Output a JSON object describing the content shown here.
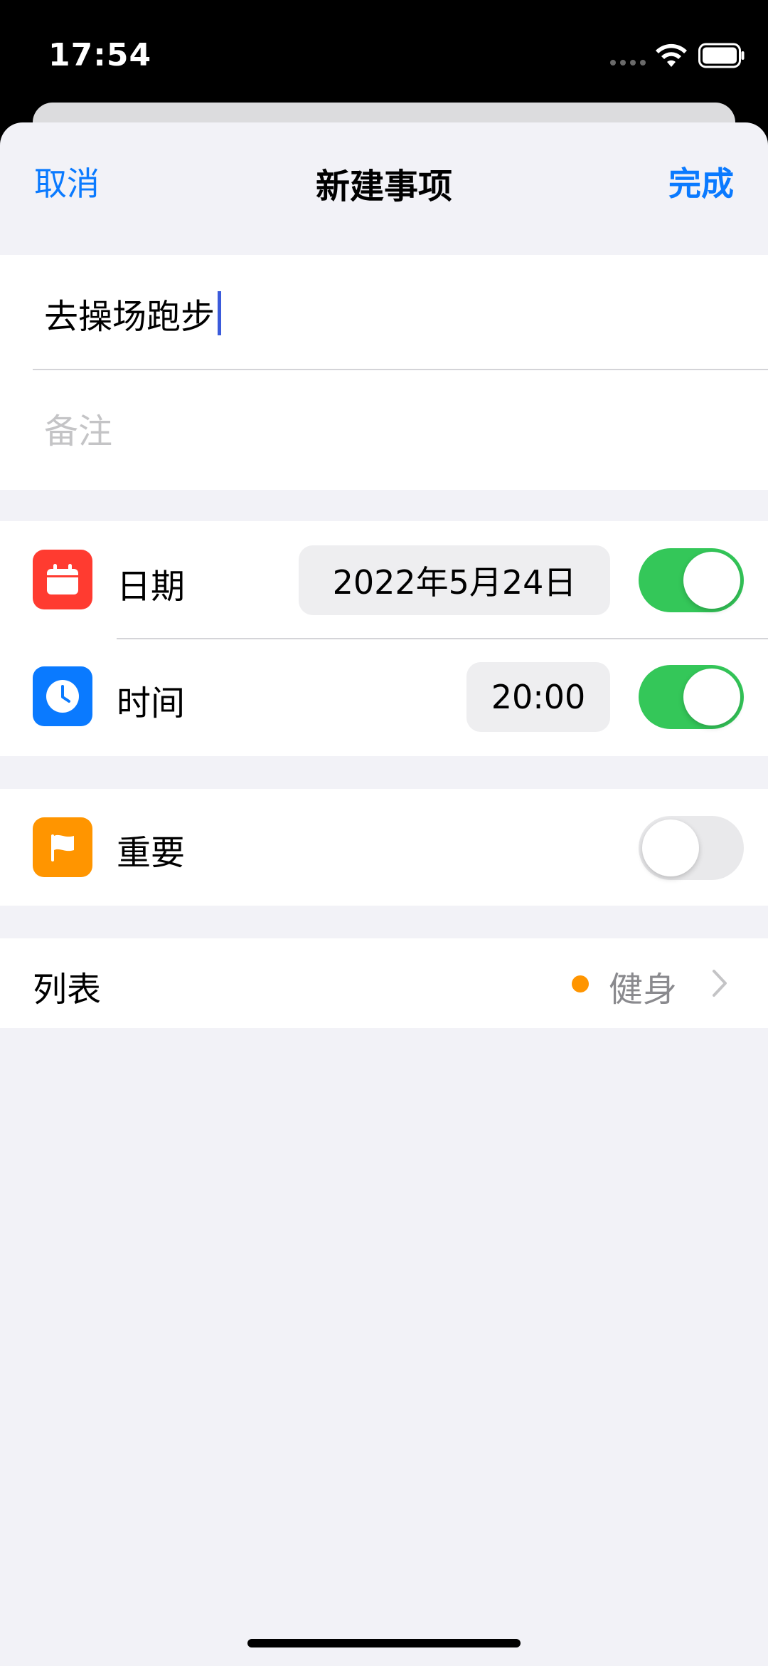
{
  "status_bar": {
    "time": "17:54",
    "wifi_icon": "wifi-icon",
    "battery_icon": "battery-icon"
  },
  "nav": {
    "cancel_label": "取消",
    "title": "新建事项",
    "done_label": "完成"
  },
  "details": {
    "title_value": "去操场跑步",
    "notes_placeholder": "备注"
  },
  "date_row": {
    "icon": "calendar-icon",
    "label": "日期",
    "value": "2022年5月24日",
    "toggle_on": true
  },
  "time_row": {
    "icon": "clock-icon",
    "label": "时间",
    "value": "20:00",
    "toggle_on": true
  },
  "flag_row": {
    "icon": "flag-icon",
    "label": "重要",
    "toggle_on": false
  },
  "list_row": {
    "label": "列表",
    "value": "健身",
    "dot_color": "#ff9500",
    "chevron_icon": "chevron-right-icon"
  },
  "colors": {
    "accent": "#0a7aff",
    "toggle_on": "#34c759",
    "calendar": "#ff3b30",
    "clock": "#0a7aff",
    "flag": "#ff9500"
  }
}
